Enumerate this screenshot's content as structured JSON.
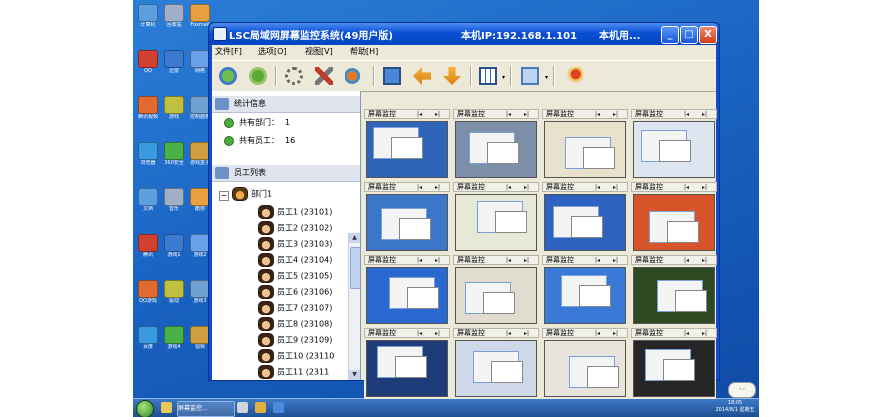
{
  "window": {
    "title": "LSC局域网屏幕监控系统(49用户版)",
    "ip": "本机IP:192.168.1.101",
    "user": "本机用...",
    "minimize": "_",
    "maximize": "□",
    "close": "X"
  },
  "menu": [
    "文件[F]",
    "选项[O]",
    "视图[V]",
    "帮助[H]"
  ],
  "toolbar": {
    "icons": [
      "connect-icon",
      "disconnect-icon",
      "settings-gear-icon",
      "tools-icon",
      "broadcast-icon",
      "monitor-icon",
      "previous-arrow-icon",
      "next-arrow-icon",
      "grid-layout-icon",
      "screenshot-icon",
      "send-message-icon"
    ]
  },
  "left": {
    "stats_title": "统计信息",
    "stats": [
      {
        "label": "共有部门：",
        "value": "1"
      },
      {
        "label": "共有员工：",
        "value": "16"
      }
    ],
    "tree_title": "员工列表",
    "dept": "部门1",
    "employees": [
      "员工1 (23101)",
      "员工2 (23102)",
      "员工3 (23103)",
      "员工4 (23104)",
      "员工5 (23105)",
      "员工6 (23106)",
      "员工7 (23107)",
      "员工8 (23108)",
      "员工9 (23109)",
      "员工10 (23110",
      "员工11 (2311"
    ]
  },
  "grid": {
    "cell_title": "屏幕监控",
    "nav_left": "|◂",
    "nav_right": "▸|",
    "thumb_colors": [
      "#2f64b8",
      "#7d8ea8",
      "#e8e2cc",
      "#dde6f0",
      "#3b76c9",
      "#e6e8d8",
      "#2d62c0",
      "#d8552a",
      "#2a6ad0",
      "#e0ddd0",
      "#3a7ad6",
      "#2d4a22",
      "#1e3c7a",
      "#cfd8e8",
      "#e8e4dc",
      "#262626"
    ]
  },
  "desktop": {
    "icons": [
      "计算机",
      "回收站",
      "Foxmail",
      "QQ",
      "迅雷",
      "网络",
      "腾讯视频",
      "游戏",
      "控制面板",
      "浏览器",
      "360安全",
      "游戏盒子",
      "文档",
      "音乐",
      "酷狗",
      "腾讯",
      "游戏1",
      "游戏2",
      "QQ游戏",
      "驱动",
      "游戏3",
      "百度",
      "游戏4",
      "视频"
    ],
    "taskbar_items": [
      "屏幕监控...",
      "资源管理器"
    ],
    "clock_time": "18:05",
    "clock_date": "2014/8/1 星期五"
  }
}
